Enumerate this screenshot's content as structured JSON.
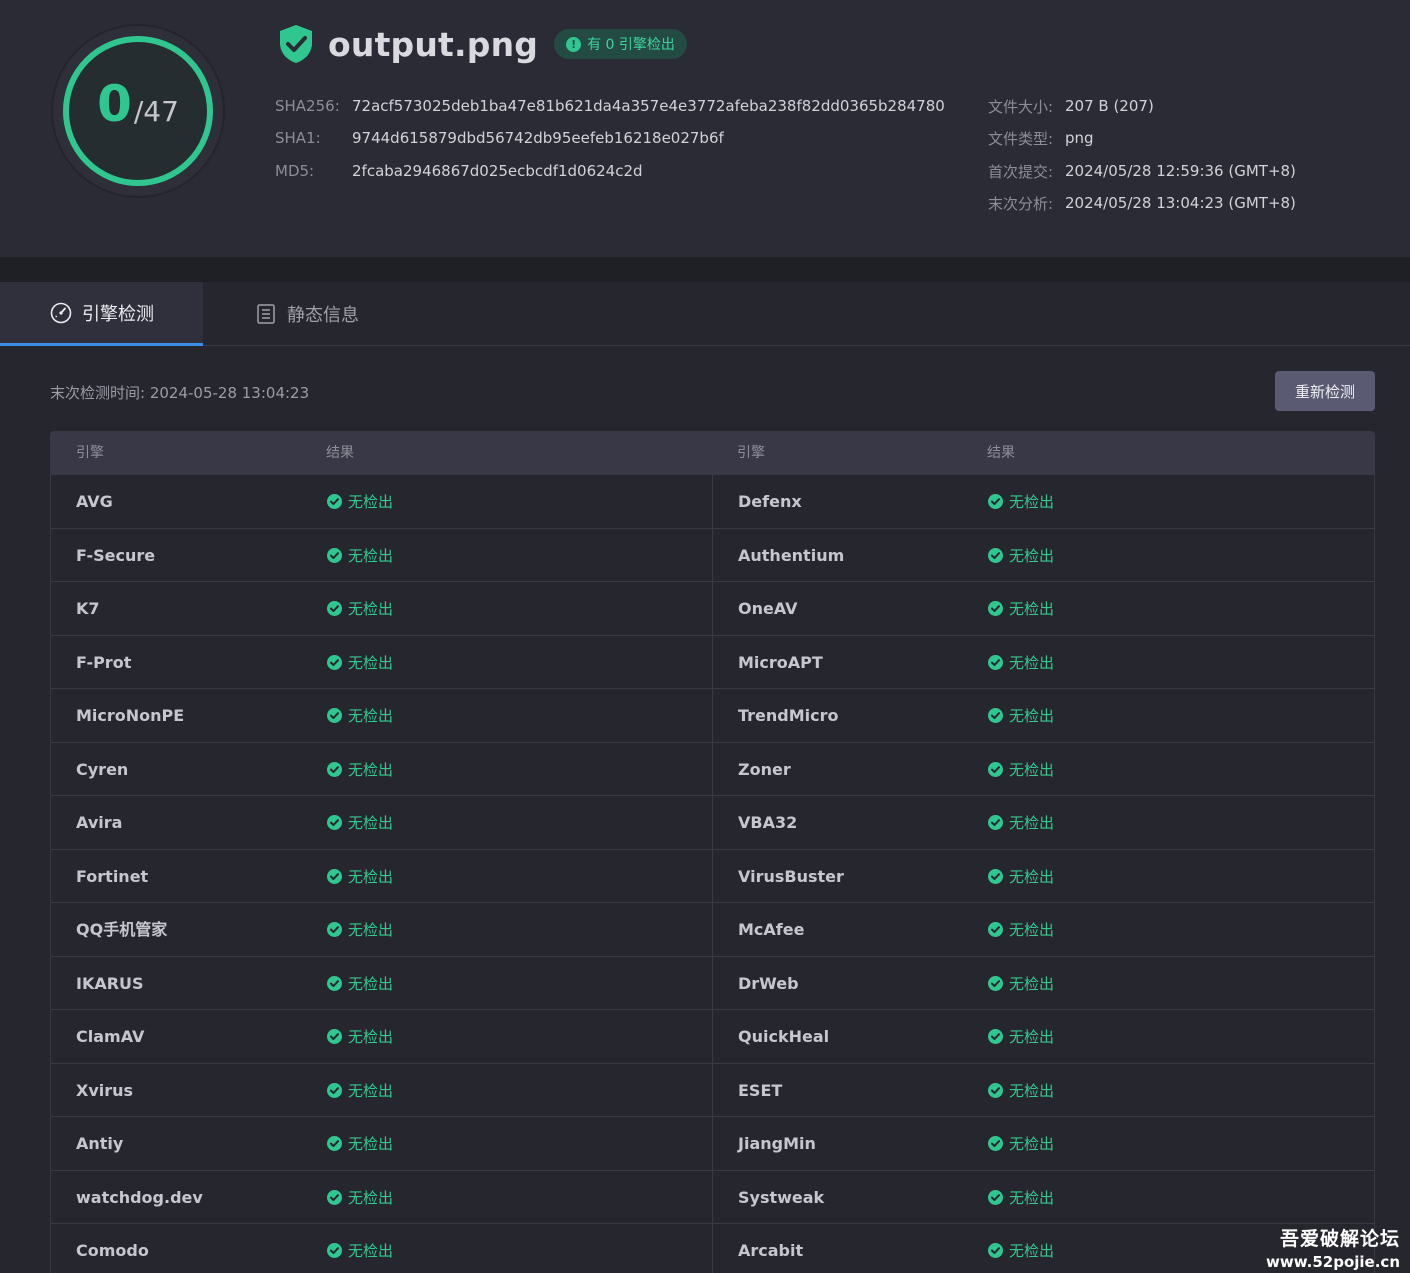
{
  "score": {
    "detected": "0",
    "slash": "/",
    "total": "47"
  },
  "file": {
    "name": "output.png",
    "badge": "有 0 引擎检出",
    "badge_icon": "!"
  },
  "hashes": [
    {
      "label": "SHA256:",
      "value": "72acf573025deb1ba47e81b621da4a357e4e3772afeba238f82dd0365b284780"
    },
    {
      "label": "SHA1:",
      "value": "9744d615879dbd56742db95eefeb16218e027b6f"
    },
    {
      "label": "MD5:",
      "value": "2fcaba2946867d025ecbcdf1d0624c2d"
    }
  ],
  "meta": [
    {
      "label": "文件大小:",
      "value": "207 B (207)"
    },
    {
      "label": "文件类型:",
      "value": "png"
    },
    {
      "label": "首次提交:",
      "value": "2024/05/28 12:59:36 (GMT+8)"
    },
    {
      "label": "末次分析:",
      "value": "2024/05/28 13:04:23 (GMT+8)"
    }
  ],
  "tabs": [
    {
      "label": "引擎检测",
      "icon": "gauge-icon",
      "active": true
    },
    {
      "label": "静态信息",
      "icon": "document-icon",
      "active": false
    }
  ],
  "toolbar": {
    "last_scan": "末次检测时间: 2024-05-28 13:04:23",
    "rescan_label": "重新检测"
  },
  "table": {
    "headers": [
      "引擎",
      "结果",
      "引擎",
      "结果"
    ],
    "rows": [
      {
        "left": {
          "engine": "AVG",
          "result": "无检出"
        },
        "right": {
          "engine": "Defenx",
          "result": "无检出"
        }
      },
      {
        "left": {
          "engine": "F-Secure",
          "result": "无检出"
        },
        "right": {
          "engine": "Authentium",
          "result": "无检出"
        }
      },
      {
        "left": {
          "engine": "K7",
          "result": "无检出"
        },
        "right": {
          "engine": "OneAV",
          "result": "无检出"
        }
      },
      {
        "left": {
          "engine": "F-Prot",
          "result": "无检出"
        },
        "right": {
          "engine": "MicroAPT",
          "result": "无检出"
        }
      },
      {
        "left": {
          "engine": "MicroNonPE",
          "result": "无检出"
        },
        "right": {
          "engine": "TrendMicro",
          "result": "无检出"
        }
      },
      {
        "left": {
          "engine": "Cyren",
          "result": "无检出"
        },
        "right": {
          "engine": "Zoner",
          "result": "无检出"
        }
      },
      {
        "left": {
          "engine": "Avira",
          "result": "无检出"
        },
        "right": {
          "engine": "VBA32",
          "result": "无检出"
        }
      },
      {
        "left": {
          "engine": "Fortinet",
          "result": "无检出"
        },
        "right": {
          "engine": "VirusBuster",
          "result": "无检出"
        }
      },
      {
        "left": {
          "engine": "QQ手机管家",
          "result": "无检出"
        },
        "right": {
          "engine": "McAfee",
          "result": "无检出"
        }
      },
      {
        "left": {
          "engine": "IKARUS",
          "result": "无检出"
        },
        "right": {
          "engine": "DrWeb",
          "result": "无检出"
        }
      },
      {
        "left": {
          "engine": "ClamAV",
          "result": "无检出"
        },
        "right": {
          "engine": "QuickHeal",
          "result": "无检出"
        }
      },
      {
        "left": {
          "engine": "Xvirus",
          "result": "无检出"
        },
        "right": {
          "engine": "ESET",
          "result": "无检出"
        }
      },
      {
        "left": {
          "engine": "Antiy",
          "result": "无检出"
        },
        "right": {
          "engine": "JiangMin",
          "result": "无检出"
        }
      },
      {
        "left": {
          "engine": "watchdog.dev",
          "result": "无检出"
        },
        "right": {
          "engine": "Systweak",
          "result": "无检出"
        }
      },
      {
        "left": {
          "engine": "Comodo",
          "result": "无检出"
        },
        "right": {
          "engine": "Arcabit",
          "result": "无检出"
        }
      }
    ]
  },
  "watermark": {
    "title": "吾爱破解论坛",
    "url": "www.52pojie.cn"
  },
  "colors": {
    "accent_green": "#2fc78f",
    "tab_active_underline": "#3b8ee8",
    "background": "#26262f",
    "header_background": "#2b2b35"
  }
}
